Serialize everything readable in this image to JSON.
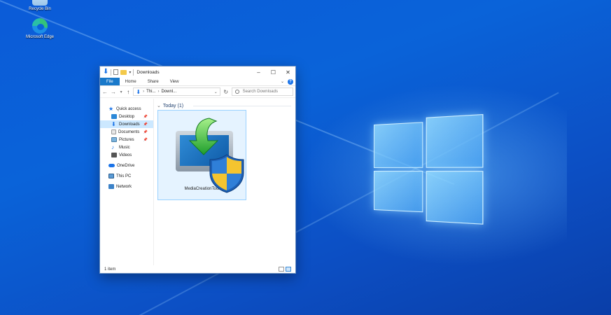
{
  "desktop": {
    "icons": [
      {
        "label": "Recycle Bin"
      },
      {
        "label": "Microsoft Edge"
      }
    ]
  },
  "window": {
    "title": "Downloads",
    "controls": {
      "minimize": "–",
      "maximize": "☐",
      "close": "✕"
    },
    "ribbon_tabs": [
      "File",
      "Home",
      "Share",
      "View"
    ],
    "address": {
      "segment_1": "Thi...",
      "segment_2": "Downl...",
      "separator": "›"
    },
    "search": {
      "placeholder": "Search Downloads"
    },
    "nav": {
      "quick_access": "Quick access",
      "items": [
        "Desktop",
        "Downloads",
        "Documents",
        "Pictures",
        "Music",
        "Videos"
      ],
      "onedrive": "OneDrive",
      "this_pc": "This PC",
      "network": "Network"
    },
    "group_header": "Today (1)",
    "files": [
      {
        "name": "MediaCreationTool"
      }
    ],
    "status": "1 item"
  },
  "colors": {
    "accent": "#1979ca",
    "selection": "#cce8ff",
    "desktop_bg": "#0a63d9"
  }
}
